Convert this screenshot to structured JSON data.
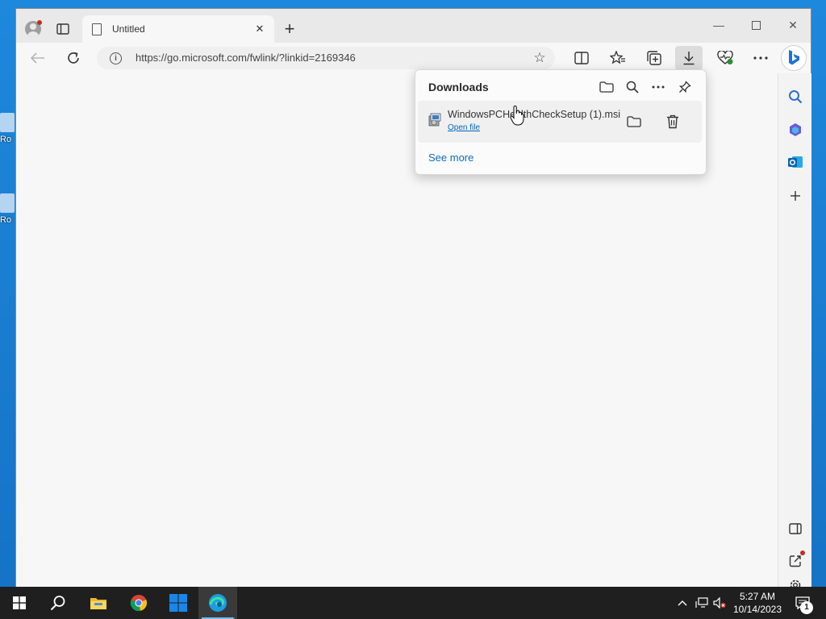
{
  "desktop": {
    "icons": [
      {
        "label": "Ro"
      },
      {
        "label": "Ro"
      }
    ]
  },
  "browser": {
    "tab": {
      "title": "Untitled"
    },
    "address": {
      "url": "https://go.microsoft.com/fwlink/?linkid=2169346"
    },
    "toolbar": {
      "icons": [
        "split-screen-icon",
        "favorites-icon",
        "collections-icon",
        "downloads-icon",
        "browser-essentials-icon",
        "more-icon",
        "bing-copilot-icon"
      ]
    },
    "sidebar": {
      "icons": [
        "search-icon",
        "copilot-icon",
        "outlook-icon",
        "add-icon",
        "hide-sidebar-icon",
        "open-external-icon",
        "settings-icon"
      ]
    }
  },
  "downloads": {
    "title": "Downloads",
    "item": {
      "filename": "WindowsPCHealthCheckSetup (1).msi",
      "action": "Open file"
    },
    "see_more": "See more"
  },
  "taskbar": {
    "clock": {
      "time": "5:27 AM",
      "date": "10/14/2023"
    },
    "notification_count": "1"
  },
  "colors": {
    "accent": "#0f6cbd",
    "taskbar": "#1f1f1f",
    "desktop": "#1a7fd4",
    "notification_dot": "#c42b1c"
  }
}
